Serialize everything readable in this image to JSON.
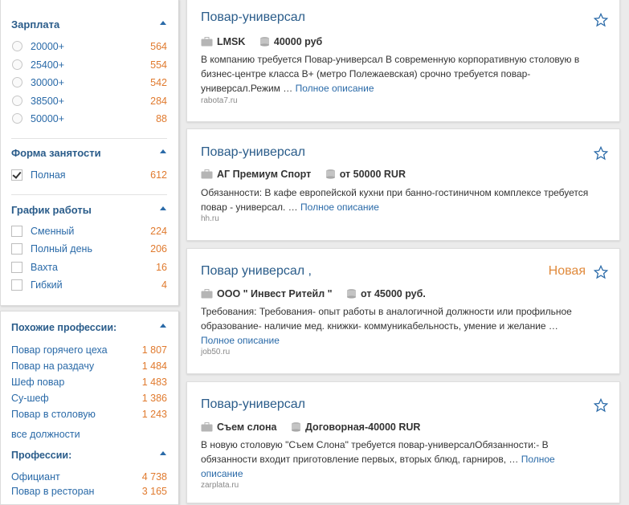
{
  "filters": {
    "salary": {
      "title": "Зарплата",
      "options": [
        {
          "label": "20000+",
          "count": "564"
        },
        {
          "label": "25400+",
          "count": "554"
        },
        {
          "label": "30000+",
          "count": "542"
        },
        {
          "label": "38500+",
          "count": "284"
        },
        {
          "label": "50000+",
          "count": "88"
        }
      ]
    },
    "employment": {
      "title": "Форма занятости",
      "options": [
        {
          "label": "Полная",
          "count": "612",
          "checked": true
        }
      ]
    },
    "schedule": {
      "title": "График работы",
      "options": [
        {
          "label": "Сменный",
          "count": "224"
        },
        {
          "label": "Полный день",
          "count": "206"
        },
        {
          "label": "Вахта",
          "count": "16"
        },
        {
          "label": "Гибкий",
          "count": "4"
        }
      ]
    }
  },
  "similar": {
    "title": "Похожие профессии:",
    "items": [
      {
        "label": "Повар горячего цеха",
        "count": "1 807"
      },
      {
        "label": "Повар на раздачу",
        "count": "1 484"
      },
      {
        "label": "Шеф повар",
        "count": "1 483"
      },
      {
        "label": "Су-шеф",
        "count": "1 386"
      },
      {
        "label": "Повар в столовую",
        "count": "1 243"
      }
    ],
    "all_link": "все должности"
  },
  "professions": {
    "title": "Профессии:",
    "items": [
      {
        "label": "Официант",
        "count": "4 738"
      },
      {
        "label": "Повар в ресторан",
        "count": "3 165"
      }
    ]
  },
  "vacancies": [
    {
      "title": "Повар-универсал",
      "company": "LMSK",
      "salary": "40000 руб",
      "description": "В компанию требуется Повар-универсал В современную корпоративную столовую в бизнес-центре класса В+ (метро Полежаевская) срочно требуется повар-универсал.Режим …",
      "more": "Полное описание",
      "source": "rabota7.ru"
    },
    {
      "title": "Повар-универсал",
      "company": "АГ Премиум Спорт",
      "salary": "от 50000 RUR",
      "description": "Обязанности: В кафе европейской кухни при банно-гостиничном комплексе требуется повар - универсал. …",
      "more": "Полное описание",
      "source": "hh.ru"
    },
    {
      "title": "Повар универсал ,",
      "badge": "Новая",
      "company": "ООО \" Инвест Ритейл \"",
      "salary": "от 45000 руб.",
      "description": "Требования: Требования- опыт работы в аналогичной должности или профильное образование- наличие мед. книжки- коммуникабельность, умение и желание …",
      "more": "Полное описание",
      "source": "job50.ru"
    },
    {
      "title": "Повар-универсал",
      "company": "Съем слона",
      "salary": "Договорная-40000 RUR",
      "description": "В новую столовую \"Съем Слона\" требуется повар-универсалОбязанности:- В обязанности входит приготовление первых, вторых блюд, гарниров, …",
      "more": "Полное описание",
      "source": "zarplata.ru"
    }
  ],
  "colors": {
    "link": "#2a6aa8",
    "count": "#e07a2e",
    "title": "#2a5c8a"
  }
}
